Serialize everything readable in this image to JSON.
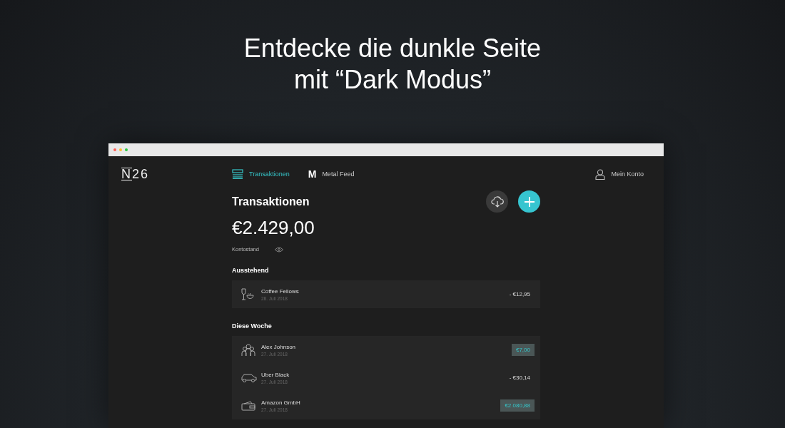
{
  "headline": {
    "lines": [
      "Entdecke die dunkle Seite",
      "mit “Dark Modus”"
    ]
  },
  "app": {
    "logo": {
      "mark": "N",
      "text": "26"
    },
    "nav": [
      {
        "label": "Transaktionen",
        "selected": true
      },
      {
        "label": "Metal Feed",
        "selected": false,
        "badge": "M"
      }
    ],
    "account": "Mein Konto",
    "page_title": "Transaktionen",
    "balance": "€2.429,00",
    "balance_label": "Kontostand",
    "sections": [
      {
        "title": "Ausstehend",
        "rows": [
          {
            "name": "Coffee Fellows",
            "date": "28. Juli 2018",
            "amount": "- €12,95",
            "kind": "expense"
          }
        ]
      },
      {
        "title": "Diese Woche",
        "rows": [
          {
            "name": "Alex Johnson",
            "date": "27. Juli 2018",
            "amount": "€7,00",
            "kind": "income"
          },
          {
            "name": "Uber Black",
            "date": "27. Juli 2018",
            "amount": "- €30,14",
            "kind": "expense"
          },
          {
            "name": "Amazon GmbH",
            "date": "27. Juli 2018",
            "amount": "€2.080,88",
            "kind": "income"
          }
        ]
      }
    ]
  }
}
